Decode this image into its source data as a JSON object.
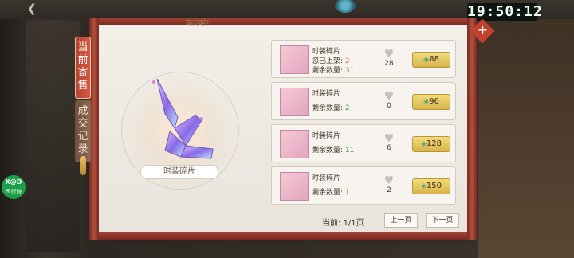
{
  "clock": "19:50:12",
  "top_hint": "询问哦!",
  "side_badge": {
    "line1": "X@D",
    "line2": "西行院"
  },
  "tabs": [
    {
      "label": "当前寄售",
      "active": true
    },
    {
      "label": "成交记录",
      "active": false
    }
  ],
  "preview": {
    "item_name": "时装碎片"
  },
  "listings": [
    {
      "name": "时装碎片",
      "line1_label": "您已上架:",
      "line1_value": "2",
      "line2_label": "剩余数量:",
      "line2_value": "31",
      "likes": "28",
      "price": "88"
    },
    {
      "name": "时装碎片",
      "line1_label": "剩余数量:",
      "line1_value": "2",
      "line2_label": "",
      "line2_value": "",
      "likes": "0",
      "price": "96"
    },
    {
      "name": "时装碎片",
      "line1_label": "剩余数量:",
      "line1_value": "11",
      "line2_label": "",
      "line2_value": "",
      "likes": "6",
      "price": "128"
    },
    {
      "name": "时装碎片",
      "line1_label": "剩余数量:",
      "line1_value": "1",
      "line2_label": "",
      "line2_value": "",
      "likes": "2",
      "price": "150"
    }
  ],
  "pagination": {
    "label": "当前:",
    "value": "1/1页",
    "prev": "上一页",
    "next": "下一页"
  },
  "icons": {
    "heart": "heart-icon",
    "currency": "jade-currency-icon",
    "close": "close-icon"
  }
}
